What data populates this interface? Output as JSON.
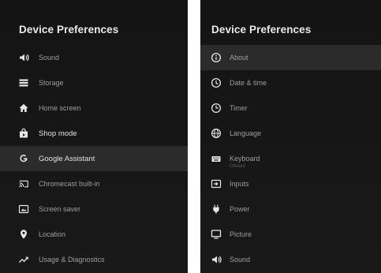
{
  "left": {
    "title": "Device Preferences",
    "items": [
      {
        "label": "Sound",
        "icon": "speaker-icon"
      },
      {
        "label": "Storage",
        "icon": "storage-icon"
      },
      {
        "label": "Home screen",
        "icon": "home-icon"
      },
      {
        "label": "Shop mode",
        "icon": "shop-bag-icon"
      },
      {
        "label": "Google Assistant",
        "icon": "google-g-icon",
        "focused": true
      },
      {
        "label": "Chromecast built-in",
        "icon": "cast-icon"
      },
      {
        "label": "Screen saver",
        "icon": "screen-saver-icon"
      },
      {
        "label": "Location",
        "icon": "location-pin-icon"
      },
      {
        "label": "Usage & Diagnostics",
        "icon": "trend-icon"
      }
    ]
  },
  "right": {
    "title": "Device Preferences",
    "items": [
      {
        "label": "About",
        "icon": "info-icon",
        "focused": true
      },
      {
        "label": "Date & time",
        "icon": "clock-icon"
      },
      {
        "label": "Timer",
        "icon": "timer-icon"
      },
      {
        "label": "Language",
        "icon": "globe-icon"
      },
      {
        "label": "Keyboard",
        "icon": "keyboard-icon",
        "sublabel": "Gboard"
      },
      {
        "label": "Inputs",
        "icon": "input-icon"
      },
      {
        "label": "Power",
        "icon": "power-plug-icon"
      },
      {
        "label": "Picture",
        "icon": "monitor-icon"
      },
      {
        "label": "Sound",
        "icon": "speaker-icon"
      }
    ]
  },
  "colors": {
    "background": "#171717",
    "focus": "#2b2b2b",
    "text": "#9e9e9e",
    "title": "#e8e8e8"
  }
}
